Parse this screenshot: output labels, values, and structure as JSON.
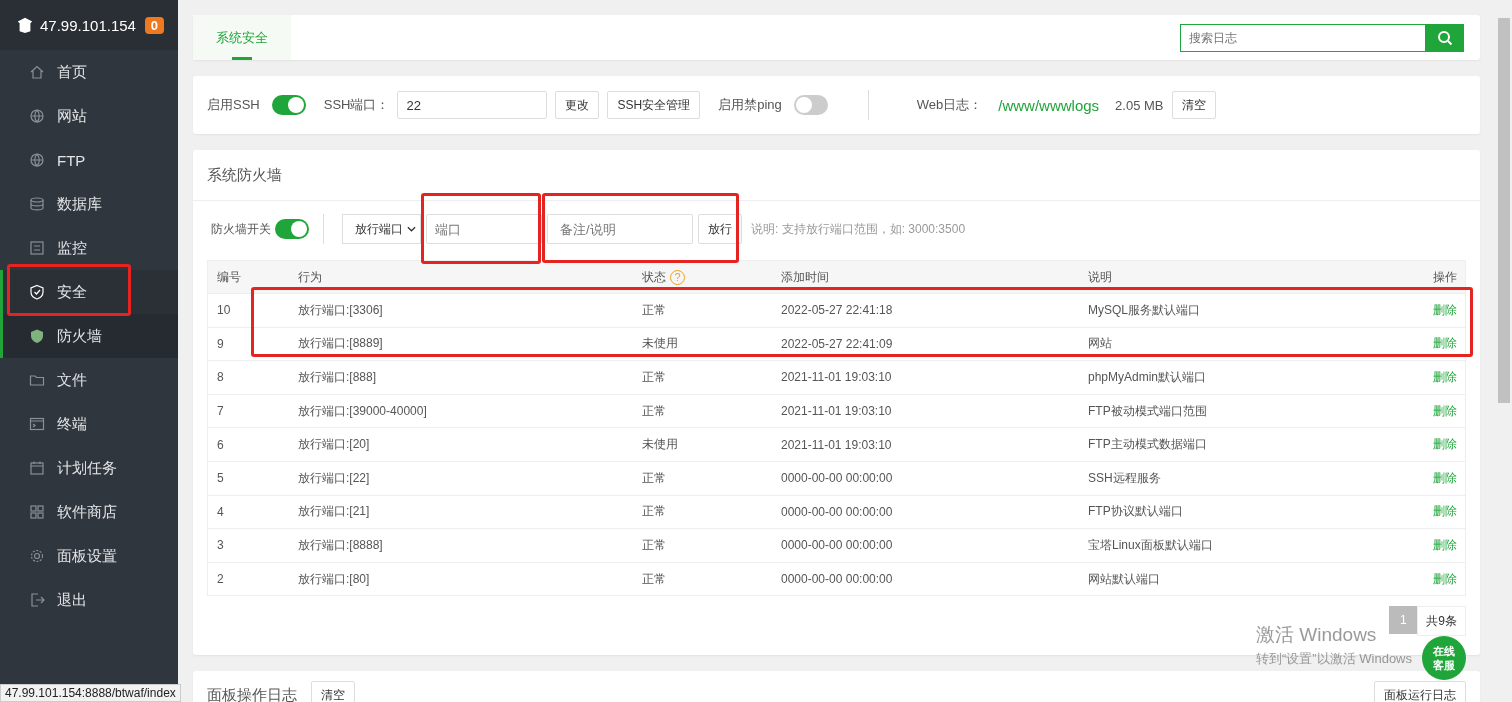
{
  "sidebar": {
    "host": "47.99.101.154",
    "badge": "0",
    "items": [
      {
        "label": "首页",
        "selected": false
      },
      {
        "label": "网站",
        "selected": false
      },
      {
        "label": "FTP",
        "selected": false
      },
      {
        "label": "数据库",
        "selected": false
      },
      {
        "label": "监控",
        "selected": false
      },
      {
        "label": "安全",
        "selected": true,
        "expanded": true,
        "children": [
          {
            "label": "防火墙",
            "selected": true
          }
        ]
      },
      {
        "label": "文件",
        "selected": false
      },
      {
        "label": "终端",
        "selected": false
      },
      {
        "label": "计划任务",
        "selected": false
      },
      {
        "label": "软件商店",
        "selected": false
      },
      {
        "label": "面板设置",
        "selected": false
      },
      {
        "label": "退出",
        "selected": false
      }
    ]
  },
  "tabs": [
    {
      "label": "系统安全",
      "selected": true
    }
  ],
  "search": {
    "placeholder": "搜索日志"
  },
  "ssh_bar": {
    "ssh_label": "启用SSH",
    "ssh_on": true,
    "port_label": "SSH端口：",
    "port_value": "22",
    "change_button": "更改",
    "manage_button": "SSH安全管理",
    "ping_label": "启用禁ping",
    "ping_on": false,
    "weblog_label": "Web日志：",
    "weblog_path": "/www/wwwlogs",
    "weblog_size": "2.05 MB",
    "clear_button": "清空"
  },
  "firewall": {
    "title": "系统防火墙",
    "switch_label": "防火墙开关",
    "on": true,
    "action_select": "放行端口",
    "port_placeholder": "端口",
    "remark_placeholder": "备注/说明",
    "submit_button": "放行",
    "hint": "说明: 支持放行端口范围，如: 3000:3500",
    "help_glyph": "?",
    "columns": [
      "编号",
      "行为",
      "状态",
      "添加时间",
      "说明",
      "操作"
    ],
    "rows": [
      {
        "id": "10",
        "action": "放行端口:[3306]",
        "status": "正常",
        "time": "2022-05-27 22:41:18",
        "remark": "MySQL服务默认端口",
        "op": "删除"
      },
      {
        "id": "9",
        "action": "放行端口:[8889]",
        "status": "未使用",
        "time": "2022-05-27 22:41:09",
        "remark": "网站",
        "op": "删除"
      },
      {
        "id": "8",
        "action": "放行端口:[888]",
        "status": "正常",
        "time": "2021-11-01 19:03:10",
        "remark": "phpMyAdmin默认端口",
        "op": "删除"
      },
      {
        "id": "7",
        "action": "放行端口:[39000-40000]",
        "status": "正常",
        "time": "2021-11-01 19:03:10",
        "remark": "FTP被动模式端口范围",
        "op": "删除"
      },
      {
        "id": "6",
        "action": "放行端口:[20]",
        "status": "未使用",
        "time": "2021-11-01 19:03:10",
        "remark": "FTP主动模式数据端口",
        "op": "删除"
      },
      {
        "id": "5",
        "action": "放行端口:[22]",
        "status": "正常",
        "time": "0000-00-00 00:00:00",
        "remark": "SSH远程服务",
        "op": "删除"
      },
      {
        "id": "4",
        "action": "放行端口:[21]",
        "status": "正常",
        "time": "0000-00-00 00:00:00",
        "remark": "FTP协议默认端口",
        "op": "删除"
      },
      {
        "id": "3",
        "action": "放行端口:[8888]",
        "status": "正常",
        "time": "0000-00-00 00:00:00",
        "remark": "宝塔Linux面板默认端口",
        "op": "删除"
      },
      {
        "id": "2",
        "action": "放行端口:[80]",
        "status": "正常",
        "time": "0000-00-00 00:00:00",
        "remark": "网站默认端口",
        "op": "删除"
      }
    ],
    "pagination": {
      "page": "1",
      "total": "共9条"
    }
  },
  "log_panel": {
    "title": "面板操作日志",
    "clear_button": "清空",
    "run_log_button": "面板运行日志"
  },
  "chat_button": "在线客服",
  "status_url": "47.99.101.154:8888/btwaf/index",
  "os_notice": {
    "title": "激活 Windows",
    "text": "转到“设置”以激活 Windows"
  }
}
